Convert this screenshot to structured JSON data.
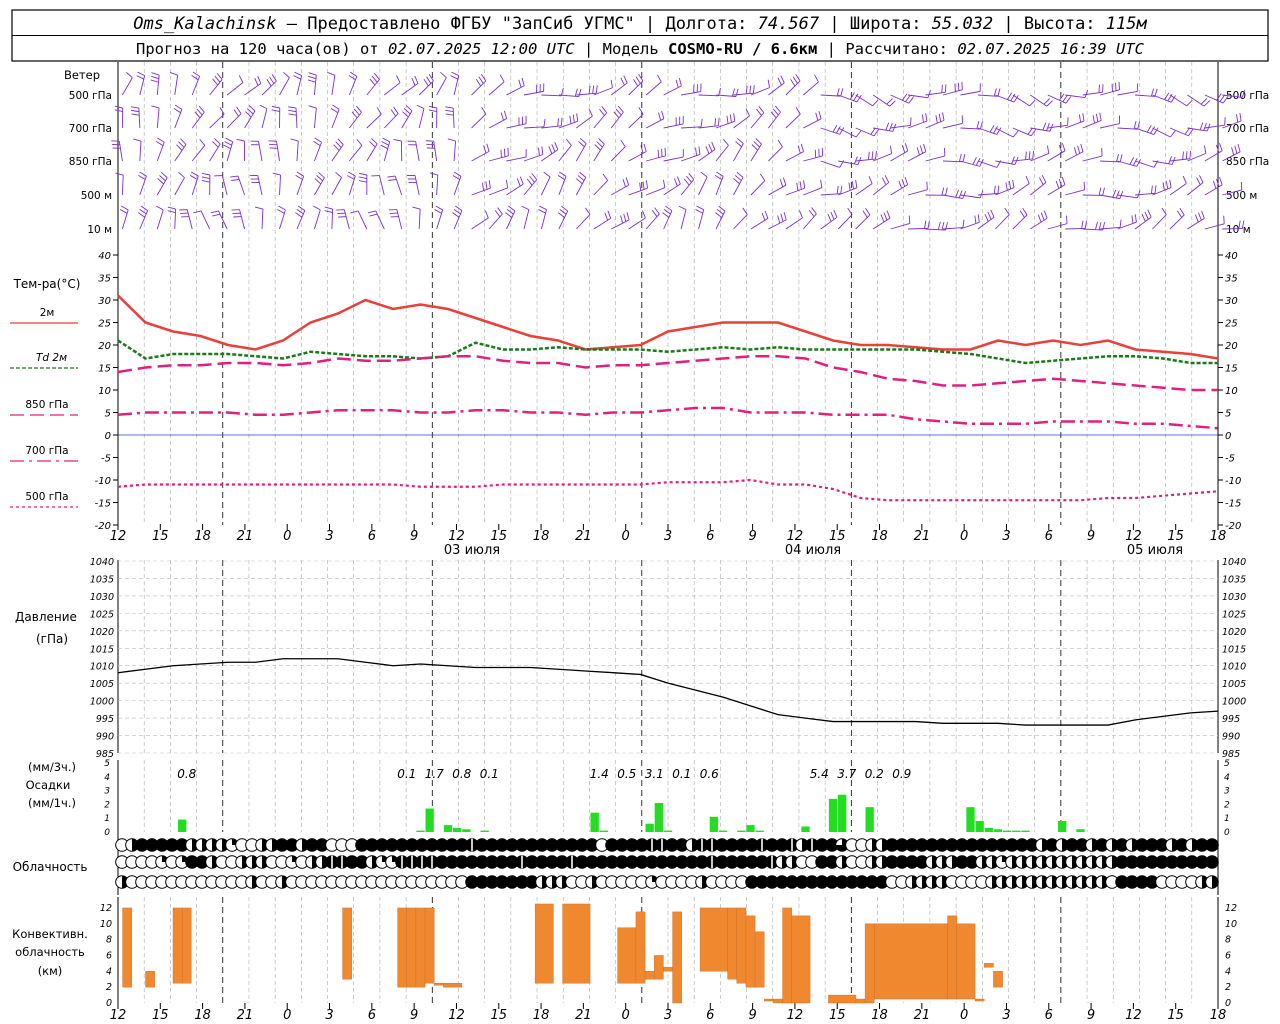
{
  "header": {
    "line1": {
      "station": "Oms_Kalachinsk",
      "provider": "Предоставлено ФГБУ \"ЗапСиб УГМС\"",
      "lon_label": "Долгота:",
      "lon": "74.567",
      "lat_label": "Широта:",
      "lat": "55.032",
      "alt_label": "Высота:",
      "alt": "115м"
    },
    "line2": {
      "forecast_label": "Прогноз на 120 часа(ов) от",
      "forecast_start": "02.07.2025 12:00 UTC",
      "model_label": "Модель",
      "model": "COSMO-RU / 6.6км",
      "computed_label": "Рассчитано:",
      "computed": "02.07.2025 16:39 UTC"
    }
  },
  "time_axis": {
    "hour_labels": [
      "12",
      "15",
      "18",
      "21",
      "0",
      "3",
      "6",
      "9",
      "12",
      "15",
      "18",
      "21",
      "0",
      "3",
      "6",
      "9",
      "12",
      "15",
      "18",
      "21",
      "0",
      "3",
      "6",
      "9",
      "12",
      "15",
      "18"
    ],
    "date_labels": [
      "03 июля",
      "04 июля",
      "05 июля"
    ]
  },
  "colors": {
    "wind": "#7b2fcf",
    "t2m": "#e8403a",
    "td": "#1a7a1a",
    "t850": "#e0207f",
    "t700": "#e0207f",
    "t500": "#e0207f",
    "zero": "#2040e0",
    "precip": "#22dd22",
    "convective": "#f08830"
  },
  "wind_panel": {
    "title": "Ветер",
    "levels": [
      "500 гПа",
      "700 гПа",
      "850 гПа",
      "500 м",
      "10  м"
    ]
  },
  "temp_panel": {
    "title": "Тем-ра(°C)",
    "legend": [
      "2м",
      "Td  2м",
      "850 гПа",
      "700 гПа",
      "500 гПа"
    ]
  },
  "pressure_panel": {
    "title": "Давление",
    "unit": "(гПа)"
  },
  "precip_panel": {
    "title_lines": [
      "(мм/3ч.)",
      "Осадки",
      "(мм/1ч.)"
    ]
  },
  "cloud_panel": {
    "title": "Облачность"
  },
  "conv_panel": {
    "title_lines": [
      "Конвективн.",
      "облачность",
      "(км)"
    ]
  },
  "chart_data": [
    {
      "type": "line",
      "name": "temperature",
      "x_hours": [
        0,
        3,
        6,
        9,
        12,
        15,
        18,
        21,
        24,
        27,
        30,
        33,
        36,
        39,
        42,
        45,
        48,
        51,
        54,
        57,
        60,
        63,
        66,
        69,
        72,
        75,
        78,
        81,
        84,
        87,
        90,
        93,
        96,
        99,
        102,
        105,
        108,
        111,
        114,
        117,
        120
      ],
      "ylim": [
        -20,
        40
      ],
      "yticks": [
        -20,
        -15,
        -10,
        -5,
        0,
        5,
        10,
        15,
        20,
        25,
        30,
        35,
        40
      ],
      "series": [
        {
          "name": "2м",
          "key": "t2m",
          "values": [
            31,
            25,
            23,
            22,
            20,
            19,
            21,
            25,
            27,
            30,
            28,
            29,
            28,
            26,
            24,
            22,
            21,
            19,
            19.5,
            20,
            23,
            24,
            25,
            25,
            25,
            23,
            21,
            20,
            20,
            19.5,
            19,
            19,
            21,
            20,
            21,
            20,
            21,
            19,
            18.5,
            18,
            17
          ]
        },
        {
          "name": "Td  2м",
          "key": "td",
          "values": [
            21,
            17,
            18,
            18,
            18,
            17.5,
            17,
            18.5,
            18,
            17.5,
            17.5,
            17,
            17.5,
            20.5,
            19,
            19,
            19.5,
            19,
            19,
            19,
            18.5,
            19,
            19.5,
            19,
            19.5,
            19,
            19,
            19,
            19,
            19,
            18.5,
            18,
            17,
            16,
            16.5,
            17,
            17.5,
            17.5,
            17,
            16,
            16
          ]
        },
        {
          "name": "850 гПа",
          "key": "t850",
          "values": [
            14,
            15,
            15.5,
            15.5,
            16,
            16,
            15.5,
            16,
            17,
            16.5,
            16.5,
            17,
            17.5,
            17.5,
            16.5,
            16,
            16,
            15,
            15.5,
            15.5,
            16,
            16.5,
            17,
            17.5,
            17.5,
            17,
            15,
            14,
            12.5,
            12,
            11,
            11,
            11.5,
            12,
            12.5,
            12,
            11.5,
            11,
            10.5,
            10,
            10
          ]
        },
        {
          "name": "700 гПа",
          "key": "t700",
          "values": [
            4.5,
            5,
            5,
            5,
            5,
            4.5,
            4.5,
            5,
            5.5,
            5.5,
            5.5,
            5,
            5,
            5.5,
            5.5,
            5,
            5,
            4.5,
            5,
            5,
            5.5,
            6,
            6,
            5,
            5,
            5,
            4.5,
            4.5,
            4.5,
            3.5,
            3,
            2.5,
            2.5,
            2.5,
            3,
            3,
            3,
            2.5,
            2.5,
            2,
            1.5
          ]
        },
        {
          "name": "500 гПа",
          "key": "t500",
          "values": [
            -11.5,
            -11,
            -11,
            -11,
            -11,
            -11,
            -11,
            -11,
            -11,
            -11,
            -11,
            -11.5,
            -11.5,
            -11.5,
            -11,
            -11,
            -11,
            -11,
            -11,
            -11,
            -10.5,
            -10.5,
            -10.5,
            -10,
            -11,
            -11,
            -12,
            -14,
            -14.5,
            -14.5,
            -14.5,
            -14.5,
            -14.5,
            -14.5,
            -14.5,
            -14.5,
            -14,
            -14,
            -13.5,
            -13,
            -12.5
          ]
        }
      ]
    },
    {
      "type": "line",
      "name": "pressure",
      "x_hours": [
        0,
        3,
        6,
        9,
        12,
        15,
        18,
        21,
        24,
        27,
        30,
        33,
        36,
        39,
        42,
        45,
        48,
        51,
        54,
        57,
        60,
        63,
        66,
        69,
        72,
        75,
        78,
        81,
        84,
        87,
        90,
        93,
        96,
        99,
        102,
        105,
        108,
        111,
        114,
        117,
        120
      ],
      "ylim": [
        985,
        1040
      ],
      "yticks": [
        985,
        990,
        995,
        1000,
        1005,
        1010,
        1015,
        1020,
        1025,
        1030,
        1035,
        1040
      ],
      "series": [
        {
          "name": "Давление",
          "values": [
            1008,
            1009,
            1010,
            1010.5,
            1011,
            1011,
            1012,
            1012,
            1012,
            1011,
            1010,
            1010.5,
            1010,
            1009.5,
            1009.5,
            1009.5,
            1009,
            1008.5,
            1008,
            1007.5,
            1005,
            1003,
            1001,
            998.5,
            996,
            995,
            994,
            994,
            994,
            994,
            993.5,
            993.5,
            993.5,
            993,
            993,
            993,
            993,
            994.5,
            995.5,
            996.5,
            997
          ]
        }
      ]
    },
    {
      "type": "bar",
      "name": "precipitation_1h",
      "ylim": [
        0,
        5
      ],
      "yticks": [
        0,
        1,
        2,
        3,
        4,
        5
      ],
      "hours": [
        7,
        33,
        34,
        36,
        37,
        38,
        40,
        52,
        53,
        58,
        59,
        60,
        65,
        66,
        68,
        69,
        70,
        75,
        78,
        79,
        82,
        93,
        94,
        95,
        96,
        97,
        98,
        99,
        103,
        105
      ],
      "values": [
        0.9,
        0.1,
        1.7,
        0.5,
        0.3,
        0.2,
        0.1,
        1.4,
        0.1,
        0.6,
        2.1,
        0.1,
        1.1,
        0.1,
        0.1,
        0.5,
        0.1,
        0.4,
        2.4,
        2.7,
        1.8,
        1.8,
        0.8,
        0.3,
        0.2,
        0.1,
        0.1,
        0.1,
        0.8,
        0.2
      ],
      "sum3h_labels": [
        {
          "hour": 7.5,
          "text": "0.8"
        },
        {
          "hour": 31.5,
          "text": "0.1"
        },
        {
          "hour": 34.5,
          "text": "1.7"
        },
        {
          "hour": 37.5,
          "text": "0.8"
        },
        {
          "hour": 40.5,
          "text": "0.1"
        },
        {
          "hour": 52.5,
          "text": "1.4"
        },
        {
          "hour": 55.5,
          "text": "0.5"
        },
        {
          "hour": 58.5,
          "text": "3.1"
        },
        {
          "hour": 61.5,
          "text": "0.1"
        },
        {
          "hour": 64.5,
          "text": "0.6"
        },
        {
          "hour": 76.5,
          "text": "5.4"
        },
        {
          "hour": 79.5,
          "text": "3.7"
        },
        {
          "hour": 82.5,
          "text": "0.2"
        },
        {
          "hour": 85.5,
          "text": "0.9"
        }
      ]
    },
    {
      "type": "table",
      "name": "cloud_cover_eighths",
      "row_order": [
        "high",
        "middle",
        "low"
      ],
      "rows": [
        [
          0,
          4,
          8,
          8,
          8,
          8,
          8,
          4,
          4,
          4,
          4,
          3,
          0,
          0,
          4,
          4,
          8,
          8,
          4,
          8,
          8,
          0,
          0,
          0,
          8,
          8,
          8,
          8,
          8,
          8,
          8,
          8,
          8,
          8,
          8,
          7,
          8,
          8,
          8,
          8,
          8,
          8,
          8,
          8,
          8,
          8,
          8,
          8,
          0,
          8,
          8,
          8,
          8,
          7,
          7,
          8,
          8,
          4,
          7,
          7,
          8,
          8,
          8,
          8,
          7,
          8,
          8,
          7,
          4,
          7,
          8,
          8,
          6,
          0,
          0,
          4,
          4,
          8,
          8,
          8,
          8,
          8,
          8,
          8,
          8,
          8,
          8,
          8,
          8,
          8,
          8,
          8,
          4,
          8,
          4,
          8,
          8,
          4,
          8,
          4,
          8,
          4,
          8,
          8,
          8,
          4,
          8,
          4,
          8,
          8,
          6
        ],
        [
          0,
          0,
          0,
          0,
          3,
          0,
          3,
          8,
          8,
          4,
          0,
          0,
          4,
          4,
          4,
          0,
          0,
          3,
          0,
          4,
          4,
          7,
          7,
          8,
          8,
          4,
          3,
          3,
          7,
          7,
          7,
          7,
          8,
          8,
          8,
          8,
          8,
          8,
          8,
          8,
          7,
          8,
          8,
          8,
          8,
          7,
          8,
          8,
          8,
          8,
          8,
          8,
          8,
          8,
          8,
          8,
          8,
          8,
          8,
          7,
          8,
          8,
          8,
          8,
          8,
          7,
          4,
          4,
          0,
          0,
          8,
          8,
          4,
          0,
          0,
          4,
          4,
          8,
          8,
          8,
          8,
          4,
          4,
          4,
          8,
          8,
          4,
          4,
          3,
          4,
          4,
          4,
          4,
          4,
          4,
          4,
          4,
          4,
          4,
          4,
          8,
          8,
          8,
          8,
          8,
          8,
          8,
          8,
          8,
          8,
          8
        ],
        [
          4,
          0,
          0,
          0,
          0,
          0,
          0,
          0,
          0,
          0,
          0,
          0,
          0,
          4,
          0,
          0,
          4,
          0,
          0,
          0,
          0,
          0,
          0,
          0,
          0,
          0,
          0,
          0,
          0,
          0,
          0,
          0,
          0,
          0,
          0,
          8,
          8,
          8,
          8,
          8,
          8,
          8,
          4,
          4,
          4,
          0,
          0,
          4,
          0,
          0,
          0,
          0,
          0,
          3,
          0,
          0,
          0,
          0,
          4,
          0,
          0,
          0,
          0,
          8,
          8,
          8,
          8,
          8,
          8,
          8,
          8,
          8,
          8,
          8,
          8,
          8,
          8,
          0,
          0,
          4,
          4,
          4,
          4,
          0,
          0,
          0,
          0,
          4,
          4,
          4,
          4,
          4,
          4,
          4,
          4,
          4,
          4,
          4,
          4,
          0,
          8,
          8,
          8,
          8,
          0,
          0,
          0,
          0,
          4,
          4,
          0,
          0,
          4
        ]
      ]
    },
    {
      "type": "bar",
      "name": "convective_cloud_km",
      "ylim": [
        0,
        13
      ],
      "yticks": [
        0,
        2,
        4,
        6,
        8,
        10,
        12
      ],
      "segments": [
        {
          "from": 0.5,
          "to": 1.5,
          "base": 2,
          "top": 12
        },
        {
          "from": 3,
          "to": 4,
          "base": 2,
          "top": 4
        },
        {
          "from": 6,
          "to": 7,
          "base": 2.5,
          "top": 12
        },
        {
          "from": 7,
          "to": 8,
          "base": 2.5,
          "top": 12
        },
        {
          "from": 24.5,
          "to": 25.5,
          "base": 3,
          "top": 12
        },
        {
          "from": 30.5,
          "to": 31.5,
          "base": 2,
          "top": 12
        },
        {
          "from": 31.5,
          "to": 32.5,
          "base": 2,
          "top": 12
        },
        {
          "from": 32.5,
          "to": 33.5,
          "base": 2,
          "top": 12
        },
        {
          "from": 33.5,
          "to": 34.5,
          "base": 2.5,
          "top": 12
        },
        {
          "from": 34.5,
          "to": 35.5,
          "base": 2.5,
          "top": 2.5
        },
        {
          "from": 35.5,
          "to": 37.5,
          "base": 2,
          "top": 2.5
        },
        {
          "from": 45.5,
          "to": 47.5,
          "base": 2.5,
          "top": 12.5
        },
        {
          "from": 48.5,
          "to": 51.5,
          "base": 2.5,
          "top": 12.5
        },
        {
          "from": 54.5,
          "to": 56.5,
          "base": 2.5,
          "top": 9.5
        },
        {
          "from": 56.5,
          "to": 57.5,
          "base": 2.5,
          "top": 11.5
        },
        {
          "from": 57.5,
          "to": 58.5,
          "base": 3,
          "top": 4
        },
        {
          "from": 58.5,
          "to": 59.5,
          "base": 3,
          "top": 6
        },
        {
          "from": 59.5,
          "to": 60.5,
          "base": 4,
          "top": 4.5
        },
        {
          "from": 60.5,
          "to": 61.5,
          "base": 0,
          "top": 11.5
        },
        {
          "from": 63.5,
          "to": 66.5,
          "base": 4,
          "top": 12
        },
        {
          "from": 66.5,
          "to": 67.5,
          "base": 3,
          "top": 12
        },
        {
          "from": 67.5,
          "to": 68.5,
          "base": 2.5,
          "top": 12
        },
        {
          "from": 68.5,
          "to": 69.5,
          "base": 2,
          "top": 11
        },
        {
          "from": 69.5,
          "to": 70.5,
          "base": 2,
          "top": 9
        },
        {
          "from": 70.5,
          "to": 71.5,
          "base": 0.5,
          "top": 0.5
        },
        {
          "from": 71.5,
          "to": 72.5,
          "base": 0,
          "top": 0.5
        },
        {
          "from": 72.5,
          "to": 73.5,
          "base": 0,
          "top": 12
        },
        {
          "from": 73.5,
          "to": 75.5,
          "base": 0,
          "top": 11
        },
        {
          "from": 77.5,
          "to": 80.5,
          "base": 0,
          "top": 1
        },
        {
          "from": 80.5,
          "to": 81.5,
          "base": 0,
          "top": 0.5
        },
        {
          "from": 81.5,
          "to": 82.5,
          "base": 0,
          "top": 10
        },
        {
          "from": 82.5,
          "to": 90.5,
          "base": 0.5,
          "top": 10
        },
        {
          "from": 90.5,
          "to": 91.5,
          "base": 0.5,
          "top": 11
        },
        {
          "from": 91.5,
          "to": 93.5,
          "base": 0.5,
          "top": 10
        },
        {
          "from": 93.5,
          "to": 94.5,
          "base": 0.5,
          "top": 0.5
        },
        {
          "from": 94.5,
          "to": 95.5,
          "base": 4.5,
          "top": 5
        },
        {
          "from": 95.5,
          "to": 96.5,
          "base": 2,
          "top": 4
        }
      ]
    }
  ]
}
